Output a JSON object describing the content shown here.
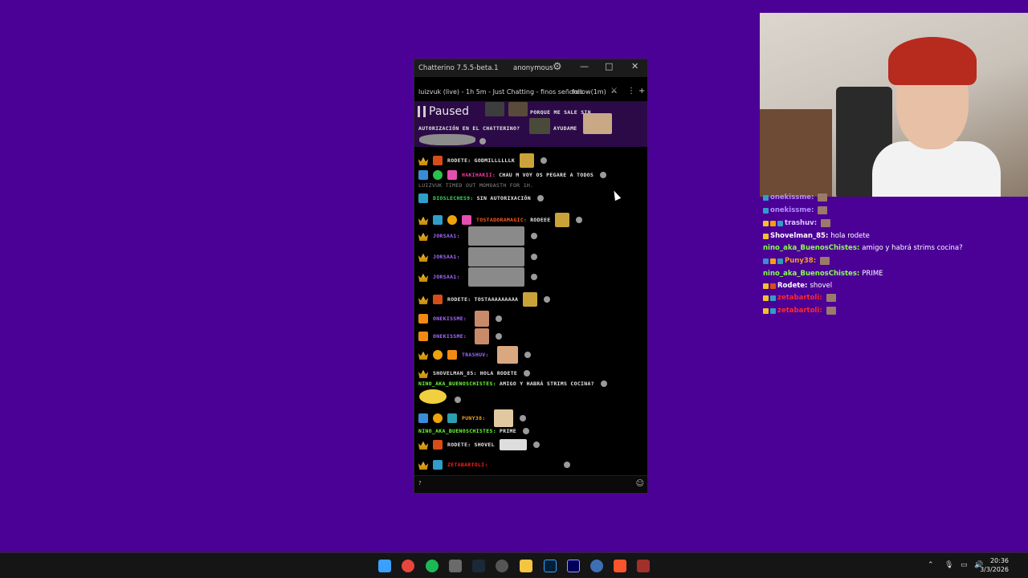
{
  "window": {
    "title": "Chatterino 7.5.5-beta.1",
    "user": "anonymous",
    "split_title": "luizvuk (live) - 1h 5m - Just Chatting - finos señores",
    "split_mode": "follow(1m)"
  },
  "paused": {
    "label": "Paused",
    "line1": "PORQUE ME SALE SIN",
    "line2": "AUTORIZACIÓN EN EL CHATTERINO?",
    "line2b": "AYUDAME"
  },
  "messages": [
    {
      "user": "RODETE:",
      "text": "GODMILLLLLLK",
      "color": "#e0e0e0"
    },
    {
      "user": "HAKIHAKII:",
      "text": "CHAU M VOY OS PEGARE A TODOS",
      "color": "#ff3aa8"
    },
    {
      "user": "",
      "text": "LUIZVUK TIMED OUT MOMOASTH FOR 1H.",
      "color": "#888"
    },
    {
      "user": "DIOSLECHES9:",
      "text": "SIN AUTORIXACIÓN",
      "color": "#3ddc5c"
    },
    {
      "user": "TOSTADORAMAGIC:",
      "text": "RODEEE",
      "color": "#ff5a1f"
    },
    {
      "user": "JORSAA1:",
      "text": "",
      "color": "#a46bff"
    },
    {
      "user": "JORSAA1:",
      "text": "",
      "color": "#a46bff"
    },
    {
      "user": "JORSAA1:",
      "text": "",
      "color": "#a46bff"
    },
    {
      "user": "RODETE:",
      "text": "TOSTAAAAAAAAA",
      "color": "#e0e0e0"
    },
    {
      "user": "ONEKISSME:",
      "text": "",
      "color": "#a46bff"
    },
    {
      "user": "ONEKISSME:",
      "text": "",
      "color": "#a46bff"
    },
    {
      "user": "TRASHUV:",
      "text": "",
      "color": "#9a6bff"
    },
    {
      "user": "SHOVELMAN_85:",
      "text": "HOLA RODETE",
      "color": "#e0e0e0"
    },
    {
      "user": "NINO_AKA_BUENOSCHISTES:",
      "text": "AMIGO Y HABRÁ STRIMS COCINA?",
      "color": "#6cff3a"
    },
    {
      "user": "PUNY38:",
      "text": "",
      "color": "#f0a020"
    },
    {
      "user": "NINO_AKA_BUENOSCHISTES:",
      "text": "PRIME",
      "color": "#6cff3a"
    },
    {
      "user": "RODETE:",
      "text": "SHOVEL",
      "color": "#e0e0e0"
    },
    {
      "user": "ZETABARTOLI:",
      "text": "",
      "color": "#ff2020"
    }
  ],
  "input": {
    "placeholder": "?"
  },
  "overlay": [
    {
      "user": "onekissme:",
      "text": "",
      "color": "#b58bff"
    },
    {
      "user": "onekissme:",
      "text": "",
      "color": "#b58bff"
    },
    {
      "user": "trashuv:",
      "text": "",
      "color": "#d9c9ff"
    },
    {
      "user": "Shovelman_85:",
      "text": "hola rodete",
      "color": "#ffffff"
    },
    {
      "user": "nino_aka_BuenosChistes:",
      "text": "amigo y habrá strims cocina?",
      "color": "#8aff52"
    },
    {
      "user": "Puny38:",
      "text": "",
      "color": "#f0a020"
    },
    {
      "user": "nino_aka_BuenosChistes:",
      "text": "PRIME",
      "color": "#8aff52"
    },
    {
      "user": "Rodete:",
      "text": "shovel",
      "color": "#ffffff"
    },
    {
      "user": "zetabartoli:",
      "text": "",
      "color": "#ff2a2a"
    },
    {
      "user": "zetabartoli:",
      "text": "",
      "color": "#ff2a2a"
    }
  ],
  "taskbar": {
    "time": "20:36",
    "date": "3/3/2026"
  },
  "colors": {
    "desktop": "#4b0096",
    "paused_bg": "#2b0a47"
  }
}
